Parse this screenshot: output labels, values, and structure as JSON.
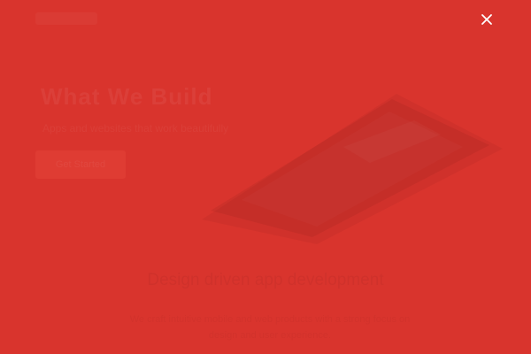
{
  "background_color": "#d9342d",
  "hero": {
    "title": "What We Build",
    "subtitle": "Apps and websites that work beautifully",
    "button_label": "Get Started"
  },
  "section": {
    "title": "Design driven app development",
    "text": "We craft intuitive mobile and web products with a strong focus on design and user experience."
  },
  "overlay": {
    "close_icon": "close-icon",
    "close_label": "Close"
  }
}
